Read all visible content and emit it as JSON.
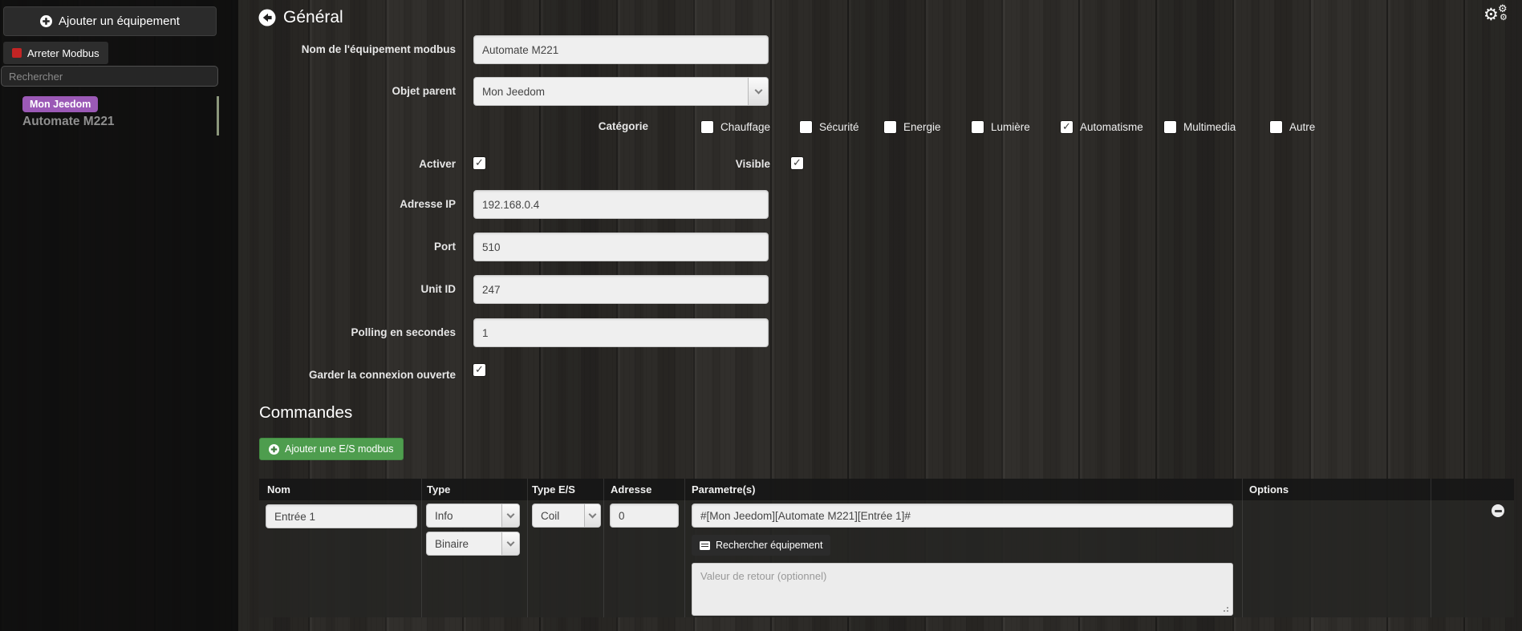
{
  "header": {
    "title": "Général"
  },
  "sidebar": {
    "add_equipment_button": "Ajouter un équipement",
    "stop_modbus_button": "Arreter Modbus",
    "search_placeholder": "Rechercher",
    "tree": {
      "object_badge": "Mon Jeedom",
      "equipment": "Automate M221"
    }
  },
  "general": {
    "name": {
      "label": "Nom de l'équipement modbus",
      "value": "Automate M221"
    },
    "parent": {
      "label": "Objet parent",
      "value": "Mon Jeedom"
    },
    "category": {
      "label": "Catégorie",
      "options": [
        {
          "label": "Chauffage",
          "checked": false
        },
        {
          "label": "Sécurité",
          "checked": false
        },
        {
          "label": "Energie",
          "checked": false
        },
        {
          "label": "Lumière",
          "checked": false
        },
        {
          "label": "Automatisme",
          "checked": true
        },
        {
          "label": "Multimedia",
          "checked": false
        },
        {
          "label": "Autre",
          "checked": false
        }
      ]
    },
    "activer": {
      "label": "Activer",
      "checked": true
    },
    "visible": {
      "label": "Visible",
      "checked": true
    },
    "ip": {
      "label": "Adresse IP",
      "value": "192.168.0.4"
    },
    "port": {
      "label": "Port",
      "value": "510"
    },
    "unit_id": {
      "label": "Unit ID",
      "value": "247"
    },
    "polling": {
      "label": "Polling en secondes",
      "value": "1"
    },
    "keep_open": {
      "label": "Garder la connexion ouverte",
      "checked": true
    }
  },
  "commands": {
    "title": "Commandes",
    "add_button": "Ajouter une E/S modbus",
    "table": {
      "headers": [
        "Nom",
        "Type",
        "Type E/S",
        "Adresse",
        "Parametre(s)",
        "Options"
      ],
      "rows": [
        {
          "nom": "Entrée 1",
          "type": "Info",
          "subtype": "Binaire",
          "type_es": "Coil",
          "adresse": "0",
          "parametre": "#[Mon Jeedom][Automate M221][Entrée 1]#",
          "search_button": "Rechercher équipement",
          "return_placeholder": "Valeur de retour (optionnel)"
        }
      ]
    }
  },
  "colors": {
    "badge_purple": "#9b59b6",
    "button_green": "#4e9d4e",
    "stop_red": "#c32424"
  }
}
